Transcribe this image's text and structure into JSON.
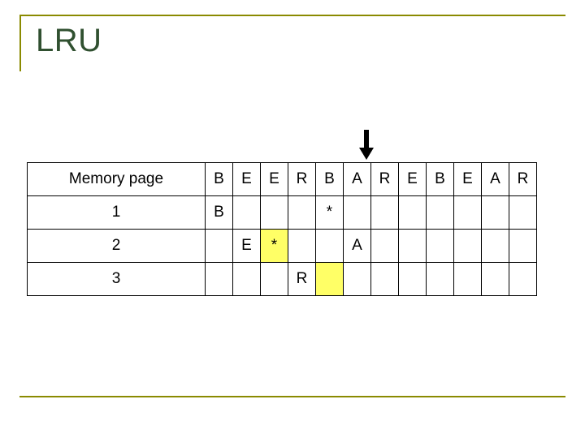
{
  "slide": {
    "title": "LRU",
    "accent_color": "#8a8a00",
    "title_color": "#305030",
    "highlight_color": "#ffff66",
    "value_color": "#b44ab4",
    "star_color": "#cc0066"
  },
  "arrow": {
    "name": "down-arrow",
    "points_to_column_index": 5
  },
  "table": {
    "row_label_header": "Memory page",
    "reference_string": [
      "B",
      "E",
      "E",
      "R",
      "B",
      "A",
      "R",
      "E",
      "B",
      "E",
      "A",
      "R"
    ],
    "rows": [
      {
        "label": "1",
        "cells": [
          {
            "text": "B",
            "style": "value",
            "highlight": false
          },
          {
            "text": "",
            "style": "",
            "highlight": false
          },
          {
            "text": "",
            "style": "",
            "highlight": false
          },
          {
            "text": "",
            "style": "",
            "highlight": false
          },
          {
            "text": "*",
            "style": "star",
            "highlight": false
          },
          {
            "text": "",
            "style": "",
            "highlight": false
          },
          {
            "text": "",
            "style": "",
            "highlight": false
          },
          {
            "text": "",
            "style": "",
            "highlight": false
          },
          {
            "text": "",
            "style": "",
            "highlight": false
          },
          {
            "text": "",
            "style": "",
            "highlight": false
          },
          {
            "text": "",
            "style": "",
            "highlight": false
          },
          {
            "text": "",
            "style": "",
            "highlight": false
          }
        ]
      },
      {
        "label": "2",
        "cells": [
          {
            "text": "",
            "style": "",
            "highlight": false
          },
          {
            "text": "E",
            "style": "value",
            "highlight": false
          },
          {
            "text": "*",
            "style": "star",
            "highlight": true
          },
          {
            "text": "",
            "style": "",
            "highlight": false
          },
          {
            "text": "",
            "style": "",
            "highlight": false
          },
          {
            "text": "A",
            "style": "value",
            "highlight": false
          },
          {
            "text": "",
            "style": "",
            "highlight": false
          },
          {
            "text": "",
            "style": "",
            "highlight": false
          },
          {
            "text": "",
            "style": "",
            "highlight": false
          },
          {
            "text": "",
            "style": "",
            "highlight": false
          },
          {
            "text": "",
            "style": "",
            "highlight": false
          },
          {
            "text": "",
            "style": "",
            "highlight": false
          }
        ]
      },
      {
        "label": "3",
        "cells": [
          {
            "text": "",
            "style": "",
            "highlight": false
          },
          {
            "text": "",
            "style": "",
            "highlight": false
          },
          {
            "text": "",
            "style": "",
            "highlight": false
          },
          {
            "text": "R",
            "style": "value",
            "highlight": false
          },
          {
            "text": "",
            "style": "",
            "highlight": true
          },
          {
            "text": "",
            "style": "",
            "highlight": false
          },
          {
            "text": "",
            "style": "",
            "highlight": false
          },
          {
            "text": "",
            "style": "",
            "highlight": false
          },
          {
            "text": "",
            "style": "",
            "highlight": false
          },
          {
            "text": "",
            "style": "",
            "highlight": false
          },
          {
            "text": "",
            "style": "",
            "highlight": false
          },
          {
            "text": "",
            "style": "",
            "highlight": false
          }
        ]
      }
    ]
  }
}
